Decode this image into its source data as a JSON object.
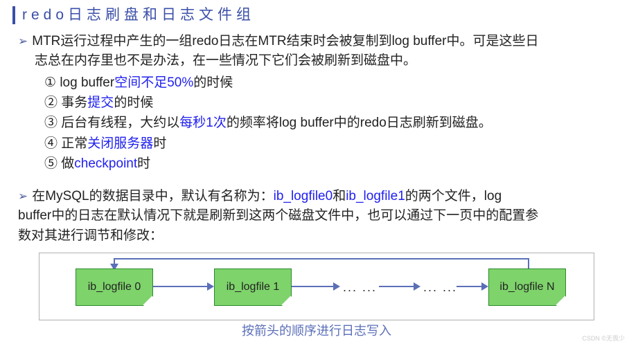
{
  "title": "redo日志刷盘和日志文件组",
  "bullet1": {
    "line1": "MTR运行过程中产生的一组redo日志在MTR结束时会被复制到log buffer中。可是这些日",
    "line2": "志总在内存里也不是办法，在一些情况下它们会被刷新到磁盘中。",
    "items": [
      {
        "num": "①",
        "pre": " log buffer",
        "hl": "空间不足50%",
        "post": "的时候"
      },
      {
        "num": "②",
        "pre": " 事务",
        "hl": "提交",
        "post": "的时候"
      },
      {
        "num": "③",
        "pre": " 后台有线程，大约以",
        "hl": "每秒1次",
        "post": "的频率将log buffer中的redo日志刷新到磁盘。"
      },
      {
        "num": "④",
        "pre": " 正常",
        "hl": "关闭服务器",
        "post": "时"
      },
      {
        "num": "⑤",
        "pre": " 做",
        "hl": "checkpoint",
        "post": "时"
      }
    ]
  },
  "bullet2": {
    "seg1": "在MySQL的数据目录中，默认有名称为：",
    "hl1": "ib_logfile0",
    "seg2": "和",
    "hl2": "ib_logfile1",
    "seg3": "的两个文件，log",
    "line2": "buffer中的日志在默认情况下就是刷新到这两个磁盘文件中，也可以通过下一页中的配置参",
    "line3": "数对其进行调节和修改："
  },
  "diagram": {
    "box0": "ib_logfile 0",
    "box1": "ib_logfile 1",
    "boxN": "ib_logfile N",
    "ellipsis1": "... ...",
    "ellipsis2": "... ..."
  },
  "caption": "按箭头的顺序进行日志写入",
  "watermark": "CSDN ©无畏少"
}
